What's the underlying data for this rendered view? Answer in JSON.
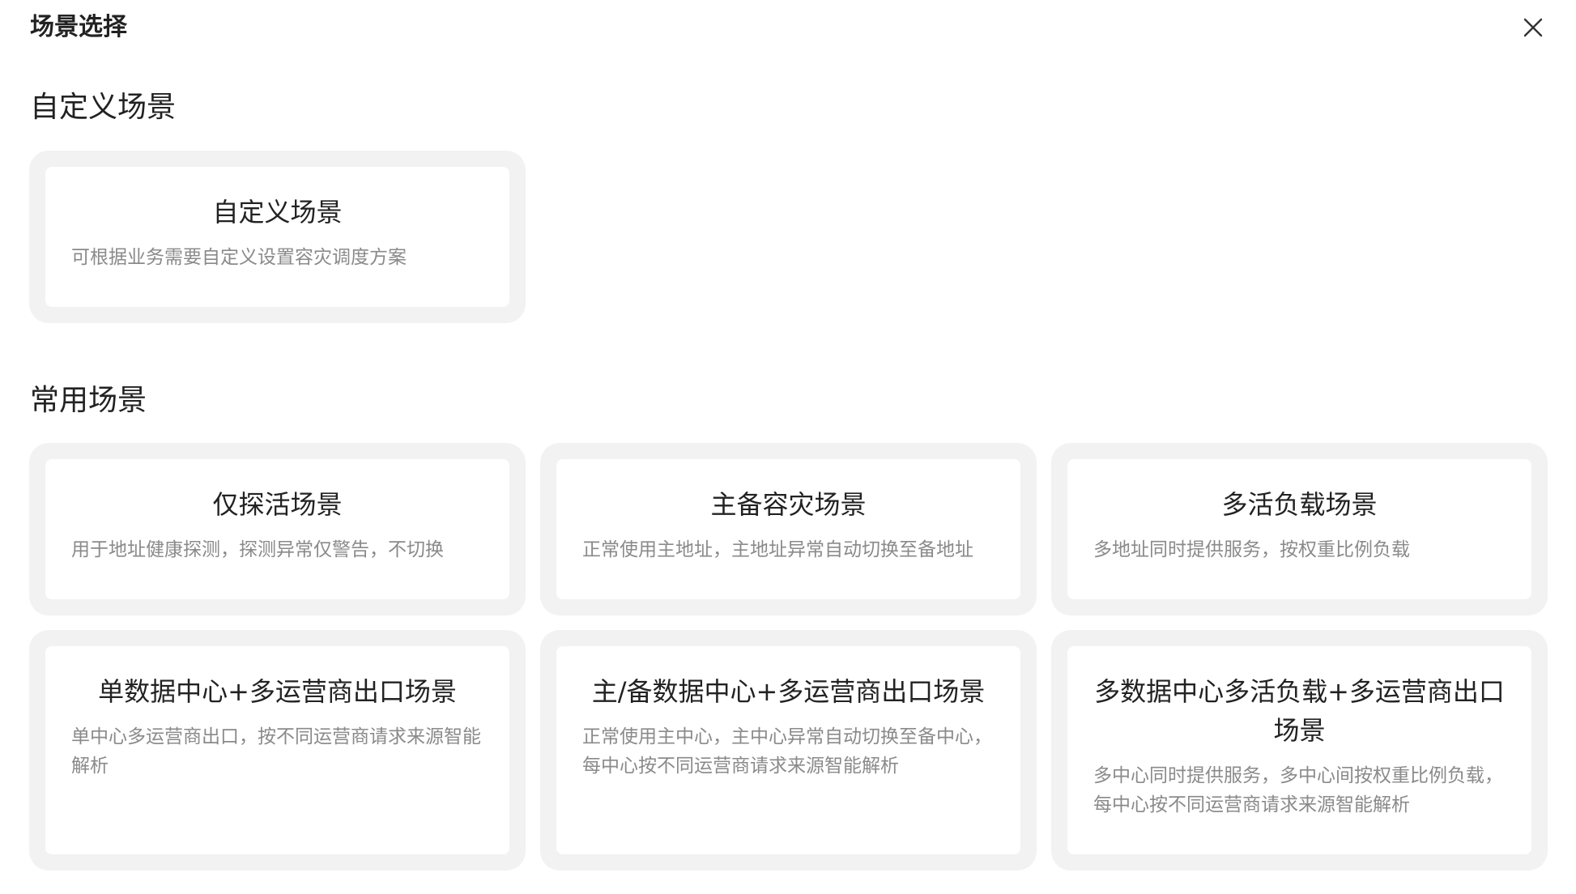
{
  "dialog": {
    "title": "场景选择",
    "close_icon": "close-icon"
  },
  "sections": {
    "custom": {
      "heading": "自定义场景",
      "cards": [
        {
          "title": "自定义场景",
          "desc": "可根据业务需要自定义设置容灾调度方案"
        }
      ]
    },
    "common": {
      "heading": "常用场景",
      "cards": [
        {
          "title": "仅探活场景",
          "desc": "用于地址健康探测，探测异常仅警告，不切换"
        },
        {
          "title": "主备容灾场景",
          "desc": "正常使用主地址，主地址异常自动切换至备地址"
        },
        {
          "title": "多活负载场景",
          "desc": "多地址同时提供服务，按权重比例负载"
        },
        {
          "title": "单数据中心+多运营商出口场景",
          "desc": "单中心多运营商出口，按不同运营商请求来源智能解析"
        },
        {
          "title": "主/备数据中心+多运营商出口场景",
          "desc": "正常使用主中心，主中心异常自动切换至备中心，每中心按不同运营商请求来源智能解析"
        },
        {
          "title": "多数据中心多活负载+多运营商出口场景",
          "desc": "多中心同时提供服务，多中心间按权重比例负载，每中心按不同运营商请求来源智能解析"
        }
      ]
    }
  },
  "colors": {
    "card_outer": "#f2f2f2",
    "card_inner": "#ffffff",
    "title_text": "#222222",
    "desc_text": "#8a8a8a"
  }
}
